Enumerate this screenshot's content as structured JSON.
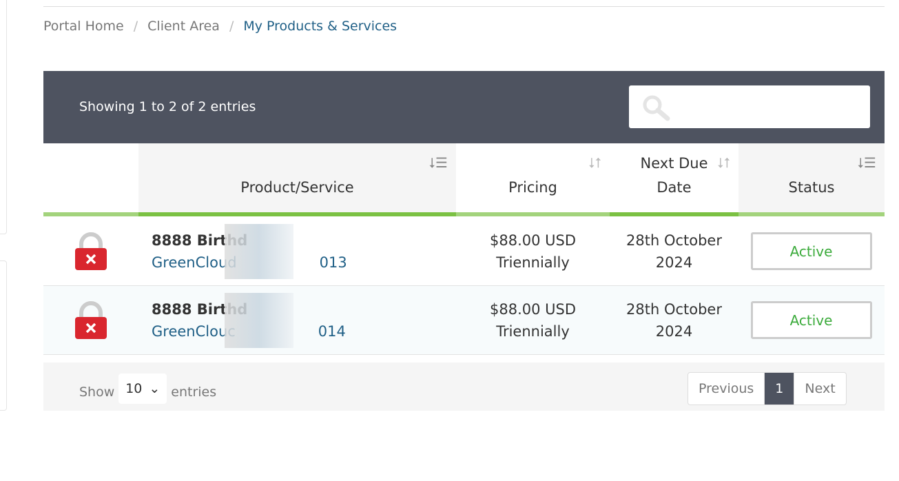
{
  "breadcrumb": [
    {
      "label": "Portal Home"
    },
    {
      "label": "Client Area"
    },
    {
      "label": "My Products & Services"
    }
  ],
  "breadcrumb_sep": "/",
  "table": {
    "info": "Showing 1 to 2 of 2 entries",
    "search": {
      "placeholder": "",
      "icon": "search-icon"
    },
    "columns": [
      {
        "label": ""
      },
      {
        "label": "Product/Service"
      },
      {
        "label": "Pricing"
      },
      {
        "label": "Next Due Date"
      },
      {
        "label": "Status"
      }
    ],
    "rows": [
      {
        "icon": "lock-cancelled-icon",
        "product": "8888 Birthd",
        "domain": "GreenCloud",
        "domain_tail": "013",
        "price": "$88.00 USD",
        "cycle": "Triennially",
        "due1": "28th October",
        "due2": "2024",
        "status": "Active"
      },
      {
        "icon": "lock-cancelled-icon",
        "product": "8888 Birthd",
        "domain": "GreenClouc",
        "domain_tail": "014",
        "price": "$88.00 USD",
        "cycle": "Triennially",
        "due1": "28th October",
        "due2": "2024",
        "status": "Active"
      }
    ],
    "length": {
      "show": "Show",
      "value": "10",
      "entries": "entries"
    },
    "pagination": {
      "previous": "Previous",
      "current": "1",
      "next": "Next"
    }
  },
  "colors": {
    "header": "#4e5360",
    "accent_green": "#7bc143",
    "status_active": "#3cab3c",
    "link": "#1f5f86",
    "lock": "#d9262e"
  }
}
